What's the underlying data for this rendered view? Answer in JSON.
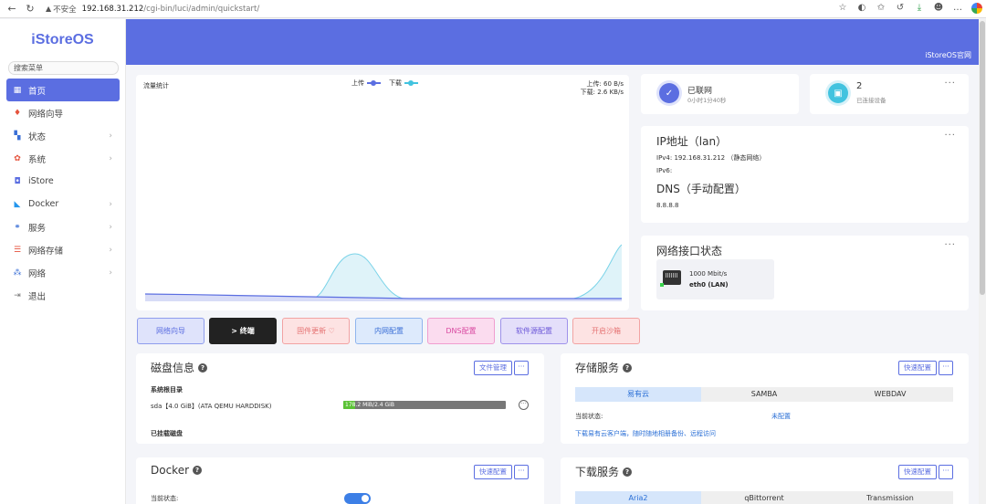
{
  "browser": {
    "insecure_label": "不安全",
    "url_host": "192.168.31.212",
    "url_path": "/cgi-bin/luci/admin/quickstart/"
  },
  "sidebar": {
    "brand": "iStoreOS",
    "search_placeholder": "搜索菜单",
    "items": [
      {
        "label": "首页",
        "icon": "dashboard-icon"
      },
      {
        "label": "网络向导",
        "icon": "wizard-icon"
      },
      {
        "label": "状态",
        "icon": "status-icon"
      },
      {
        "label": "系统",
        "icon": "gear-icon"
      },
      {
        "label": "iStore",
        "icon": "store-icon"
      },
      {
        "label": "Docker",
        "icon": "docker-icon"
      },
      {
        "label": "服务",
        "icon": "services-icon"
      },
      {
        "label": "网络存储",
        "icon": "storage-icon"
      },
      {
        "label": "网络",
        "icon": "network-icon"
      },
      {
        "label": "退出",
        "icon": "logout-icon"
      }
    ]
  },
  "header": {
    "link": "iStoreOS官网"
  },
  "traffic": {
    "title": "流量统计",
    "legend_up": "上传",
    "legend_down": "下载",
    "up_rate": "上传: 60 B/s",
    "down_rate": "下载: 2.6 KB/s",
    "colors": {
      "up": "#5b6ee1",
      "down": "#42c3df"
    }
  },
  "quick_buttons": [
    {
      "label": "网络向导"
    },
    {
      "label": "> 终端"
    },
    {
      "label": "固件更新 ♡"
    },
    {
      "label": "内网配置"
    },
    {
      "label": "DNS配置"
    },
    {
      "label": "软件源配置"
    },
    {
      "label": "开启沙箱"
    }
  ],
  "status": {
    "network_state": "已联网",
    "uptime": "0小时1分40秒",
    "devices_count": "2",
    "devices_label": "已连接设备",
    "more": "···"
  },
  "ip": {
    "title": "IP地址（lan）",
    "ipv4": "IPv4: 192.168.31.212 （静态网络）",
    "ipv6": "IPv6:",
    "dns_title": "DNS（手动配置）",
    "dns": "8.8.8.8"
  },
  "net_iface": {
    "title": "网络接口状态",
    "speed": "1000 Mbit/s",
    "name": "eth0 (LAN)"
  },
  "disk": {
    "title": "磁盘信息",
    "btn_files": "文件管理",
    "more": "···",
    "root_label": "系统根目录",
    "device": "sda【4.0 GiB】(ATA QEMU HARDDISK)",
    "usage_text": "178.2 MiB/2.4 GiB",
    "usage_fraction": 0.0725,
    "mounted_label": "已挂载磁盘"
  },
  "storage": {
    "title": "存储服务",
    "btn_config": "快速配置",
    "more": "···",
    "tabs": [
      "易有云",
      "SAMBA",
      "WEBDAV"
    ],
    "status_label": "当前状态:",
    "status_value": "未配置",
    "link": "下载易有云客户端，随时随地相册备份、远程访问"
  },
  "docker": {
    "title": "Docker",
    "btn_config": "快速配置",
    "more": "···",
    "status_label": "当前状态:"
  },
  "download": {
    "title": "下载服务",
    "btn_config": "快速配置",
    "more": "···",
    "tabs": [
      "Aria2",
      "qBittorrent",
      "Transmission"
    ]
  }
}
